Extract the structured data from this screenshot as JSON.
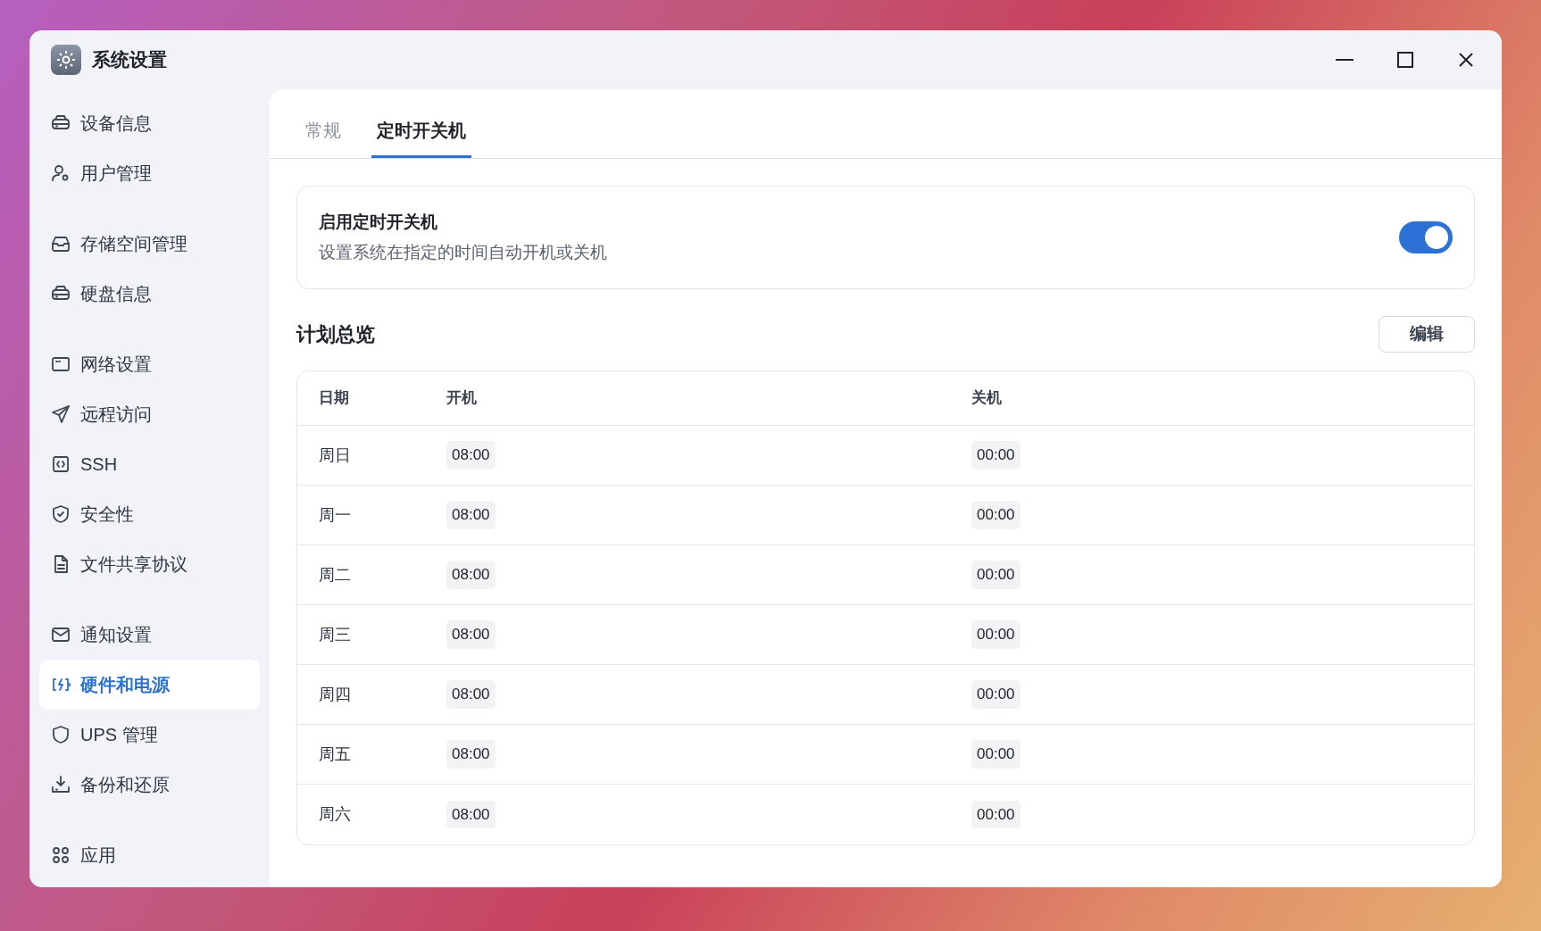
{
  "window": {
    "title": "系统设置"
  },
  "sidebar": {
    "groups": [
      {
        "items": [
          {
            "label": "设备信息",
            "selected": false
          },
          {
            "label": "用户管理",
            "selected": false
          }
        ]
      },
      {
        "items": [
          {
            "label": "存储空间管理",
            "selected": false
          },
          {
            "label": "硬盘信息",
            "selected": false
          }
        ]
      },
      {
        "items": [
          {
            "label": "网络设置",
            "selected": false
          },
          {
            "label": "远程访问",
            "selected": false
          },
          {
            "label": "SSH",
            "selected": false
          },
          {
            "label": "安全性",
            "selected": false
          },
          {
            "label": "文件共享协议",
            "selected": false
          }
        ]
      },
      {
        "items": [
          {
            "label": "通知设置",
            "selected": false
          },
          {
            "label": "硬件和电源",
            "selected": true
          },
          {
            "label": "UPS 管理",
            "selected": false
          },
          {
            "label": "备份和还原",
            "selected": false
          }
        ]
      },
      {
        "items": [
          {
            "label": "应用",
            "selected": false
          }
        ]
      }
    ]
  },
  "tabs": [
    {
      "label": "常规",
      "selected": false
    },
    {
      "label": "定时开关机",
      "selected": true
    }
  ],
  "setting": {
    "title": "启用定时开关机",
    "description": "设置系统在指定的时间自动开机或关机",
    "on": true
  },
  "schedule": {
    "title": "计划总览",
    "edit_button": "编辑",
    "columns": [
      "日期",
      "开机",
      "关机"
    ],
    "rows": [
      {
        "day": "周日",
        "on_time": "08:00",
        "off_time": "00:00"
      },
      {
        "day": "周一",
        "on_time": "08:00",
        "off_time": "00:00"
      },
      {
        "day": "周二",
        "on_time": "08:00",
        "off_time": "00:00"
      },
      {
        "day": "周三",
        "on_time": "08:00",
        "off_time": "00:00"
      },
      {
        "day": "周四",
        "on_time": "08:00",
        "off_time": "00:00"
      },
      {
        "day": "周五",
        "on_time": "08:00",
        "off_time": "00:00"
      },
      {
        "day": "周六",
        "on_time": "08:00",
        "off_time": "00:00"
      }
    ]
  }
}
